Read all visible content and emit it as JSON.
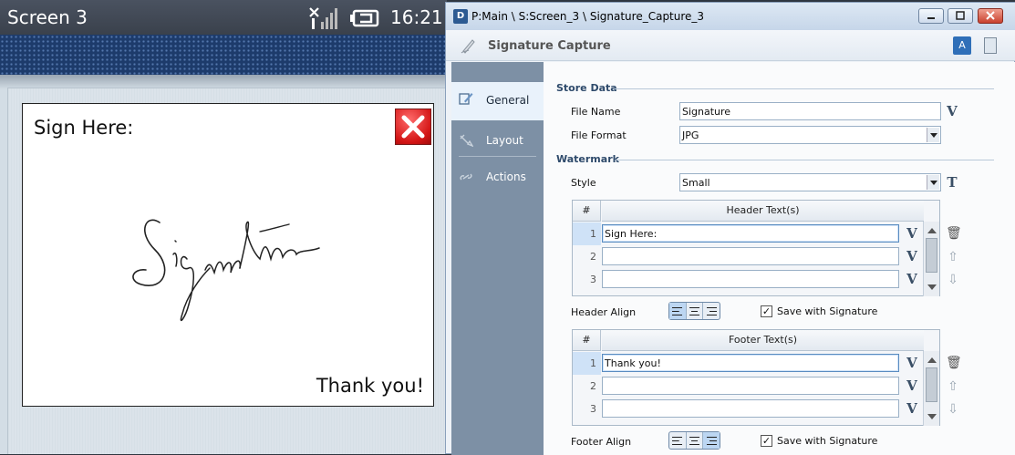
{
  "device": {
    "title": "Screen 3",
    "time": "16:21",
    "signal_icon": "signal-bars-icon",
    "battery_icon": "battery-charging-icon",
    "panel": {
      "prompt": "Sign Here:",
      "footer": "Thank you!",
      "close_icon": "red-x-close-icon"
    }
  },
  "editor": {
    "window_title": "P:Main \\ S:Screen_3 \\ Signature_Capture_3",
    "app_icon_letter": "D",
    "header_title": "Signature Capture",
    "nav": [
      {
        "label": "General",
        "selected": true
      },
      {
        "label": "Layout",
        "selected": false
      },
      {
        "label": "Actions",
        "selected": false
      }
    ],
    "store_data": {
      "section": "Store Data",
      "file_name_label": "File Name",
      "file_name_value": "Signature",
      "file_format_label": "File Format",
      "file_format_value": "JPG"
    },
    "watermark": {
      "section": "Watermark",
      "style_label": "Style",
      "style_value": "Small",
      "header_grid": {
        "col_hash": "#",
        "col_text": "Header Text(s)",
        "rows": [
          {
            "num": "1",
            "value": "Sign Here:"
          },
          {
            "num": "2",
            "value": ""
          },
          {
            "num": "3",
            "value": ""
          }
        ]
      },
      "header_align_label": "Header Align",
      "header_align_selected": "left",
      "header_save_label": "Save with Signature",
      "header_save_checked": "✓",
      "footer_grid": {
        "col_hash": "#",
        "col_text": "Footer Text(s)",
        "rows": [
          {
            "num": "1",
            "value": "Thank you!"
          },
          {
            "num": "2",
            "value": ""
          },
          {
            "num": "3",
            "value": ""
          }
        ]
      },
      "footer_align_label": "Footer Align",
      "footer_align_selected": "right",
      "footer_save_label": "Save with Signature",
      "footer_save_checked": "✓"
    },
    "variable_button_label": "V",
    "text_button_label": "T",
    "translate_label": "A"
  },
  "colors": {
    "nav_bg": "#7d90a5",
    "device_banner": "#1d3b6b",
    "selected_row": "#cfe2f7"
  }
}
